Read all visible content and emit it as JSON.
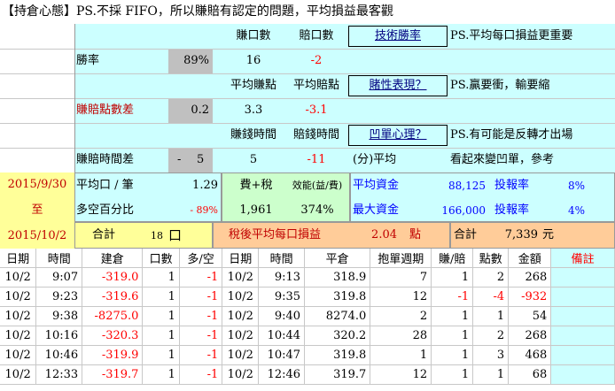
{
  "header": "【持倉心態】PS.不採 FIFO，所以賺賠有認定的問題，平均損益最客觀",
  "stats": {
    "col_win_count": "賺口數",
    "col_loss_count": "賠口數",
    "btn_tech_win": "技術勝率",
    "note1": "PS.平均每口損益更重要",
    "win_rate_label": "勝率",
    "win_rate_value": "89%",
    "win_count": "16",
    "loss_count": "-2",
    "col_avg_win_pts": "平均賺點",
    "col_avg_loss_pts": "平均賠點",
    "btn_gamble": "賭性表現？",
    "note2": "PS.贏要衝，輸要縮",
    "pts_diff_label": "賺賠點數差",
    "pts_diff_value": "0.2",
    "avg_win_pts": "3.3",
    "avg_loss_pts": "-3.1",
    "col_win_time": "賺錢時間",
    "col_loss_time": "賠錢時間",
    "btn_concave": "凹單心理？",
    "note3": "PS.有可能是反轉才出場",
    "time_diff_label": "賺賠時間差",
    "time_diff_sign": "-",
    "time_diff_value": "5",
    "win_time": "5",
    "loss_time": "-11",
    "time_unit": "(分)平均",
    "note4": "看起來變凹單，參考"
  },
  "summary": {
    "date_from": "2015/9/30",
    "to": "至",
    "date_to": "2015/10/2",
    "avg_per_lot_label": "平均口 / 筆",
    "avg_per_lot_value": "1.29",
    "fee_tax_label": "費+稅",
    "efficiency_label": "效能(益/費)",
    "avg_capital_label": "平均資金",
    "avg_capital_value": "88,125",
    "invest_rate_label1": "投報率",
    "invest_rate_value1": "8%",
    "long_short_label": "多空百分比",
    "long_short_value": "- 89%",
    "fee_tax_value": "1,961",
    "efficiency_value": "374%",
    "max_capital_label": "最大資金",
    "max_capital_value": "166,000",
    "invest_rate_label2": "投報率",
    "invest_rate_value2": "4%",
    "total_label": "合計",
    "total_lots": "18",
    "total_lots_unit": "口",
    "after_tax_label": "稅後平均每口損益",
    "after_tax_value": "2.04",
    "after_tax_unit": "點",
    "total_amount_label": "合計",
    "total_amount_value": "7,339",
    "total_amount_unit": "元"
  },
  "table": {
    "headers": [
      "日期",
      "時間",
      "建倉",
      "口數",
      "多/空",
      "日期",
      "時間",
      "平倉",
      "抱單週期",
      "賺/賠",
      "點數",
      "金額",
      "備註"
    ],
    "rows": [
      [
        "10/2",
        "9:07",
        "-319.0",
        "1",
        "-1",
        "10/2",
        "9:13",
        "318.9",
        "7",
        "1",
        "2",
        "268",
        ""
      ],
      [
        "10/2",
        "9:23",
        "-319.6",
        "1",
        "-1",
        "10/2",
        "9:35",
        "319.8",
        "12",
        "-1",
        "-4",
        "-932",
        ""
      ],
      [
        "10/2",
        "9:38",
        "-8275.0",
        "1",
        "-1",
        "10/2",
        "9:40",
        "8274.0",
        "2",
        "1",
        "1",
        "54",
        ""
      ],
      [
        "10/2",
        "10:16",
        "-320.3",
        "1",
        "-1",
        "10/2",
        "10:44",
        "320.2",
        "28",
        "1",
        "2",
        "268",
        ""
      ],
      [
        "10/2",
        "10:46",
        "-319.9",
        "1",
        "-1",
        "10/2",
        "10:47",
        "319.8",
        "1",
        "1",
        "3",
        "468",
        ""
      ],
      [
        "10/2",
        "12:33",
        "-319.7",
        "1",
        "-1",
        "10/2",
        "12:46",
        "319.7",
        "12",
        "1",
        "1",
        "68",
        ""
      ]
    ]
  }
}
